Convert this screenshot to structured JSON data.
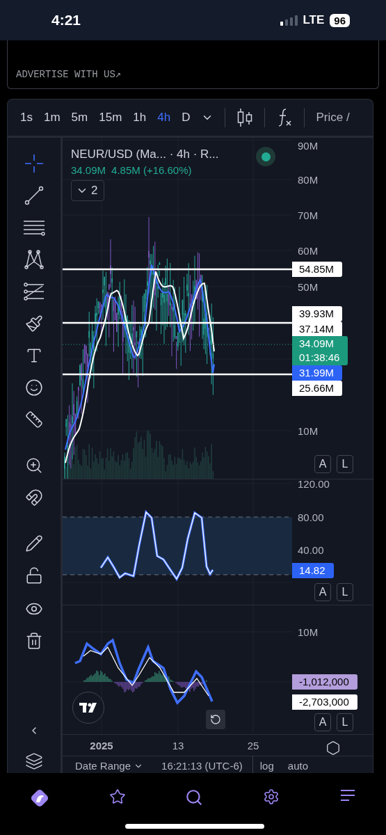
{
  "status_bar": {
    "time": "4:21",
    "network": "LTE",
    "battery": "96"
  },
  "ad": {
    "link": "ADVERTISE WITH US↗"
  },
  "toolbar": {
    "intervals": [
      {
        "label": "1s",
        "selected": false
      },
      {
        "label": "1m",
        "selected": false
      },
      {
        "label": "5m",
        "selected": false
      },
      {
        "label": "15m",
        "selected": false
      },
      {
        "label": "1h",
        "selected": false
      },
      {
        "label": "4h",
        "selected": true
      },
      {
        "label": "D",
        "selected": false
      }
    ],
    "price_label": "Price /"
  },
  "tools": [
    {
      "selected": true
    },
    {
      "selected": false
    },
    {
      "selected": false
    },
    {
      "selected": false
    },
    {
      "selected": false
    },
    {
      "selected": false
    },
    {
      "selected": false
    },
    {
      "selected": false
    },
    {
      "selected": false
    },
    {
      "selected": false
    },
    {
      "selected": false
    },
    {
      "selected": false
    },
    {
      "selected": false
    },
    {
      "selected": false
    },
    {
      "selected": false
    }
  ],
  "legend": {
    "title": "NEUR/USD (Ma... · 4h · R...",
    "last": "34.09M",
    "change": "4.85M (+16.60%)",
    "collapsed_count": "2"
  },
  "price_pane": {
    "axis_labels": [
      "90M",
      "80M",
      "70M",
      "60M",
      "50M",
      "10M"
    ],
    "scale_buttons": [
      "A",
      "L"
    ],
    "tags": [
      {
        "text": "54.85M",
        "kind": "line"
      },
      {
        "text": "39.93M",
        "kind": "line"
      },
      {
        "text": "37.14M",
        "kind": "line"
      },
      {
        "text": "34.09M",
        "subtext": "01:38:46",
        "kind": "last"
      },
      {
        "text": "31.99M",
        "kind": "average"
      },
      {
        "text": "25.66M",
        "kind": "line"
      }
    ]
  },
  "oscillator_pane": {
    "axis_labels": [
      "120.00",
      "80.00",
      "40.00"
    ],
    "scale_buttons": [
      "A",
      "L"
    ],
    "tags": [
      {
        "text": "14.82",
        "kind": "average"
      }
    ]
  },
  "macd_pane": {
    "axis_labels": [
      "10M"
    ],
    "scale_buttons": [
      "A",
      "L"
    ],
    "tags": [
      {
        "text": "-1,012,000",
        "kind": "signal"
      },
      {
        "text": "-2,703,000",
        "kind": "line"
      }
    ]
  },
  "time_axis": [
    {
      "label": "2025",
      "kind": "year"
    },
    {
      "label": "13",
      "kind": "day"
    },
    {
      "label": "25",
      "kind": "day"
    }
  ],
  "footer": {
    "date_range": "Date Range",
    "time": "16:21:13 (UTC-6)",
    "scale": "log",
    "auto": "auto"
  }
}
